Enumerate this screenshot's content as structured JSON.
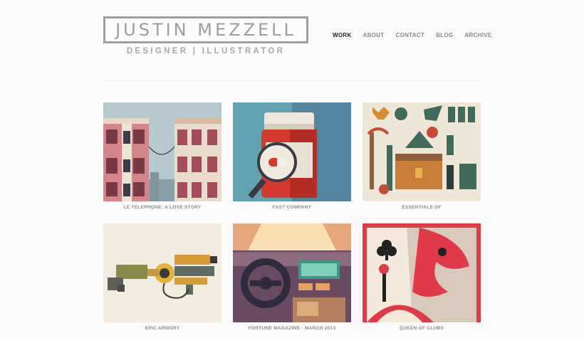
{
  "header": {
    "name": "JUSTIN MEZZELL",
    "tagline": "DESIGNER | ILLUSTRATOR"
  },
  "nav": {
    "items": [
      {
        "label": "WORK",
        "active": true
      },
      {
        "label": "ABOUT",
        "active": false
      },
      {
        "label": "CONTACT",
        "active": false
      },
      {
        "label": "BLOG",
        "active": false
      },
      {
        "label": "ARCHIVE",
        "active": false
      }
    ]
  },
  "portfolio": {
    "items": [
      {
        "title": "LE TELEPHONE: A LOVE STORY"
      },
      {
        "title": "FAST COMPANY"
      },
      {
        "title": "ESSENTIALS OF"
      },
      {
        "title": "EPIC ARMORY"
      },
      {
        "title": "FORTUNE MAGAZINE - MARCH 2013"
      },
      {
        "title": "QUEEN OF CLUBS"
      }
    ]
  },
  "colors": {
    "nav_active": "#222222",
    "nav_inactive": "#888888",
    "logo_gray": "#9d9d9d"
  }
}
